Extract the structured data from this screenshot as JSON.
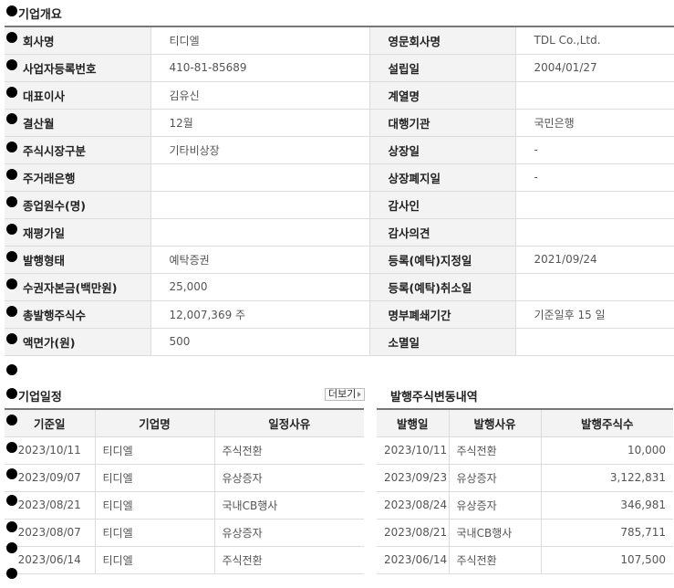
{
  "overview": {
    "title": "기업개요",
    "rows": [
      [
        "회사명",
        "티디엘",
        "영문회사명",
        "TDL Co.,Ltd."
      ],
      [
        "사업자등록번호",
        "410-81-85689",
        "설립일",
        "2004/01/27"
      ],
      [
        "대표이사",
        "김유신",
        "계열명",
        ""
      ],
      [
        "결산월",
        "12월",
        "대행기관",
        "국민은행"
      ],
      [
        "주식시장구분",
        "기타비상장",
        "상장일",
        "-"
      ],
      [
        "주거래은행",
        "",
        "상장폐지일",
        "-"
      ],
      [
        "종업원수(명)",
        "",
        "감사인",
        ""
      ],
      [
        "재평가일",
        "",
        "감사의견",
        ""
      ],
      [
        "발행형태",
        "예탁증권",
        "등록(예탁)지정일",
        "2021/09/24"
      ],
      [
        "수권자본금(백만원)",
        "25,000",
        "등록(예탁)취소일",
        ""
      ],
      [
        "총발행주식수",
        "12,007,369 주",
        "명부폐쇄기간",
        "기준일후 15 일"
      ],
      [
        "액면가(원)",
        "500",
        "소멸일",
        ""
      ]
    ]
  },
  "schedule": {
    "title": "기업일정",
    "more_label": "더보기",
    "headers": [
      "기준일",
      "기업명",
      "일정사유"
    ],
    "rows": [
      [
        "2023/10/11",
        "티디엘",
        "주식전환"
      ],
      [
        "2023/09/07",
        "티디엘",
        "유상증자"
      ],
      [
        "2023/08/21",
        "티디엘",
        "국내CB행사"
      ],
      [
        "2023/08/07",
        "티디엘",
        "유상증자"
      ],
      [
        "2023/06/14",
        "티디엘",
        "주식전환"
      ]
    ]
  },
  "issuance": {
    "title": "발행주식변동내역",
    "headers": [
      "발행일",
      "발행사유",
      "발행주식수"
    ],
    "rows": [
      [
        "2023/10/11",
        "주식전환",
        "10,000"
      ],
      [
        "2023/09/23",
        "유상증자",
        "3,122,831"
      ],
      [
        "2023/08/24",
        "유상증자",
        "346,981"
      ],
      [
        "2023/08/21",
        "국내CB행사",
        "785,711"
      ],
      [
        "2023/06/14",
        "주식전환",
        "107,500"
      ]
    ]
  }
}
